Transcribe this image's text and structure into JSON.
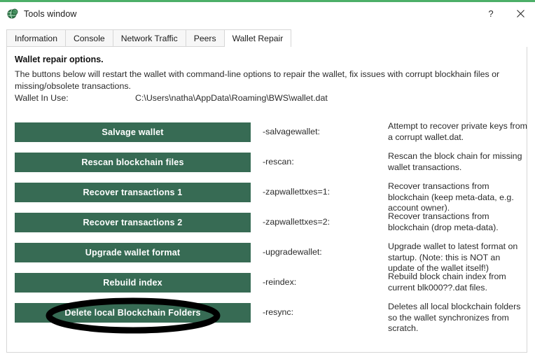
{
  "window": {
    "title": "Tools window",
    "icon": "coin-globe-icon",
    "accent_color": "#4caf68",
    "help_label": "?",
    "close_label": "×"
  },
  "tabs": [
    {
      "label": "Information",
      "active": false
    },
    {
      "label": "Console",
      "active": false
    },
    {
      "label": "Network Traffic",
      "active": false
    },
    {
      "label": "Peers",
      "active": false
    },
    {
      "label": "Wallet Repair",
      "active": true
    }
  ],
  "main": {
    "heading": "Wallet repair options.",
    "intro": "The buttons below will restart the wallet with command-line options to repair the wallet, fix issues with corrupt blockhain files or missing/obsolete transactions.",
    "wallet_in_use_label": "Wallet In Use:",
    "wallet_in_use_path": "C:\\Users\\natha\\AppData\\Roaming\\BWS\\wallet.dat",
    "button_color": "#376b54",
    "rows": [
      {
        "button": "Salvage wallet",
        "flag": "-salvagewallet:",
        "description": "Attempt to recover private keys from a corrupt wallet.dat."
      },
      {
        "button": "Rescan blockchain files",
        "flag": "-rescan:",
        "description": "Rescan the block chain for missing wallet transactions."
      },
      {
        "button": "Recover transactions 1",
        "flag": "-zapwallettxes=1:",
        "description": "Recover transactions from blockchain (keep meta-data, e.g. account owner)."
      },
      {
        "button": "Recover transactions 2",
        "flag": "-zapwallettxes=2:",
        "description": "Recover transactions from blockchain (drop meta-data)."
      },
      {
        "button": "Upgrade wallet format",
        "flag": "-upgradewallet:",
        "description": "Upgrade wallet to latest format on startup. (Note: this is NOT an update of the wallet itself!)"
      },
      {
        "button": "Rebuild index",
        "flag": "-reindex:",
        "description": "Rebuild block chain index from current blk000??.dat files."
      },
      {
        "button": "Delete local Blockchain Folders",
        "flag": "-resync:",
        "description": "Deletes all local blockchain folders so the wallet synchronizes from scratch."
      }
    ]
  },
  "annotation": {
    "shape": "ellipse-highlight",
    "color": "#000000",
    "target": "Delete local Blockchain Folders"
  }
}
